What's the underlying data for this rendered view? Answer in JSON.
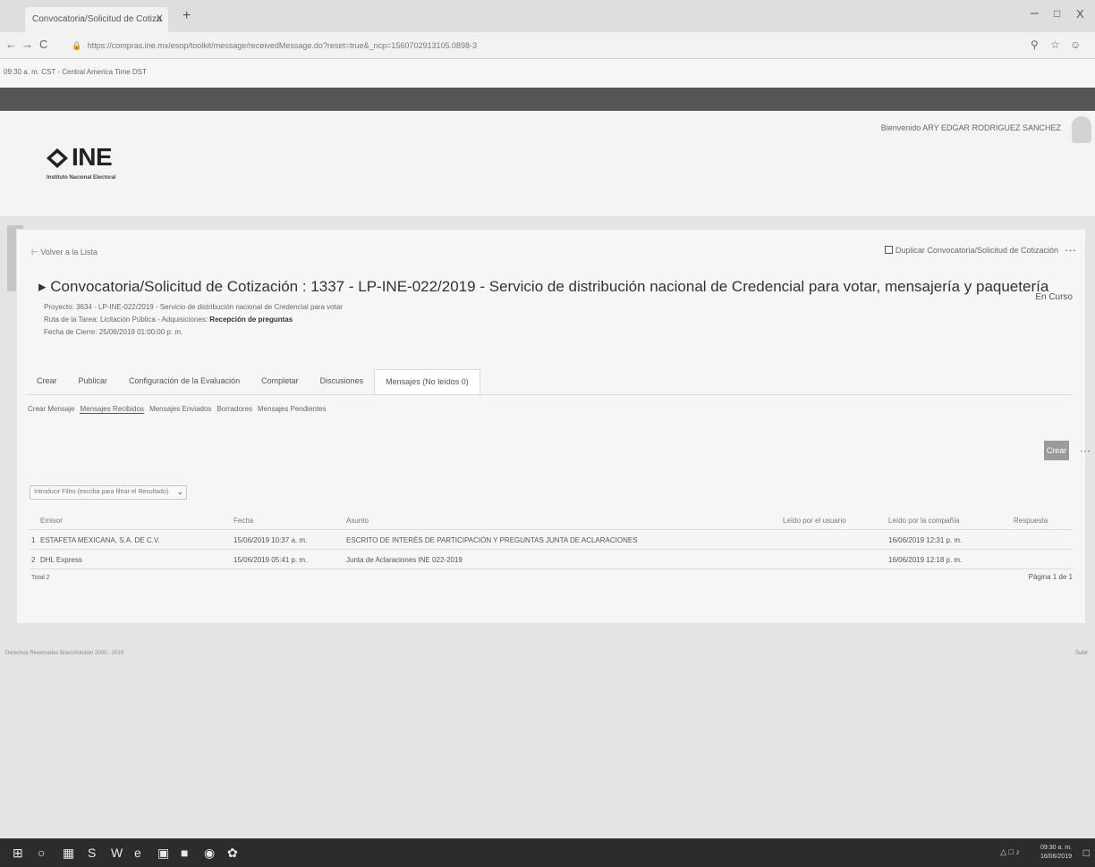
{
  "browser": {
    "tab_title": "Convocatoria/Solicitud de Cotiza",
    "tab_close": "X",
    "new_tab": "+",
    "url": "https://compras.ine.mx/esop/toolkit/message/receivedMessage.do?reset=true&_ncp=1560702913105.0898-3",
    "url_prefix_icon": "lock-icon",
    "nav": {
      "back": "←",
      "forward": "→",
      "reload": "C"
    },
    "icons": {
      "zoom": "search-icon",
      "star": "star-icon",
      "profile": "profile-icon"
    }
  },
  "timezone_text": "09:30 a. m. CST - Central America Time DST",
  "header": {
    "welcome": "Bienvenido ARY EDGAR RODRIGUEZ SANCHEZ",
    "logo_text": "INE",
    "logo_sub": "Instituto Nacional Electoral"
  },
  "card": {
    "back_link": "Volver a la Lista",
    "duplicate_label": "Duplicar Convocatoria/Solicitud de Cotización",
    "more": "···",
    "title": "Convocatoria/Solicitud de Cotización : 1337 - LP-INE-022/2019 - Servicio de distribución nacional de Credencial para votar, mensajería y paquetería",
    "status": "En Curso",
    "project": "Proyecto: 3634 - LP-INE-022/2019 - Servicio de distribución nacional de Credencial para votar",
    "route_prefix": "Ruta de la Tarea: Licitación Pública - Adquisiciones: ",
    "route_strong": "Recepción de preguntas",
    "deadline": "Fecha de Cierre: 25/06/2019 01:00:00 p. m."
  },
  "tabs": [
    {
      "label": "Crear"
    },
    {
      "label": "Publicar"
    },
    {
      "label": "Configuración de la Evaluación"
    },
    {
      "label": "Completar"
    },
    {
      "label": "Discusiones"
    },
    {
      "label": "Mensajes (No leídos 0)"
    }
  ],
  "subtabs": [
    {
      "label": "Crear Mensaje"
    },
    {
      "label": "Mensajes Recibidos"
    },
    {
      "label": "Mensajes Enviados"
    },
    {
      "label": "Borradores"
    },
    {
      "label": "Mensajes Pendientes"
    }
  ],
  "create_button": "Crear",
  "create_more": "···",
  "filter": {
    "value": "Introducir Filtro (escriba para filtrar el Resultado)"
  },
  "table": {
    "headers": {
      "sender": "Emisor",
      "date": "Fecha",
      "subject": "Asunto",
      "read_buyer": "Leído por el usuario",
      "read_company": "Leído por la compañía",
      "answer": "Respuesta"
    },
    "rows": [
      {
        "index": "1",
        "sender": "ESTAFETA MEXICANA, S.A. DE C.V.",
        "date": "15/06/2019 10:37 a. m.",
        "subject": "ESCRITO DE INTERÉS DE PARTICIPACIÓN Y PREGUNTAS JUNTA DE ACLARACIONES",
        "read_buyer": "",
        "read_company": "16/06/2019 12:31 p. m.",
        "answer": ""
      },
      {
        "index": "2",
        "sender": "DHL Express",
        "date": "15/06/2019 05:41 p. m.",
        "subject": "Junta de Aclaraciones INE 022-2019",
        "read_buyer": "",
        "read_company": "16/06/2019 12:18 p. m.",
        "answer": ""
      }
    ],
    "total": "Total 2",
    "pagination": "Página 1 de 1"
  },
  "footer": {
    "text": "Derechos Reservados BravoSolution 2000 - 2019",
    "right": "Subir"
  },
  "taskbar": {
    "clock_time": "09:30 a. m.",
    "clock_date": "16/06/2019",
    "icons": [
      "windows-start-icon",
      "search-icon",
      "task-view-icon",
      "skype-icon",
      "word-icon",
      "edge-icon",
      "store-icon",
      "file-explorer-icon",
      "chrome-icon",
      "app-icon"
    ]
  }
}
